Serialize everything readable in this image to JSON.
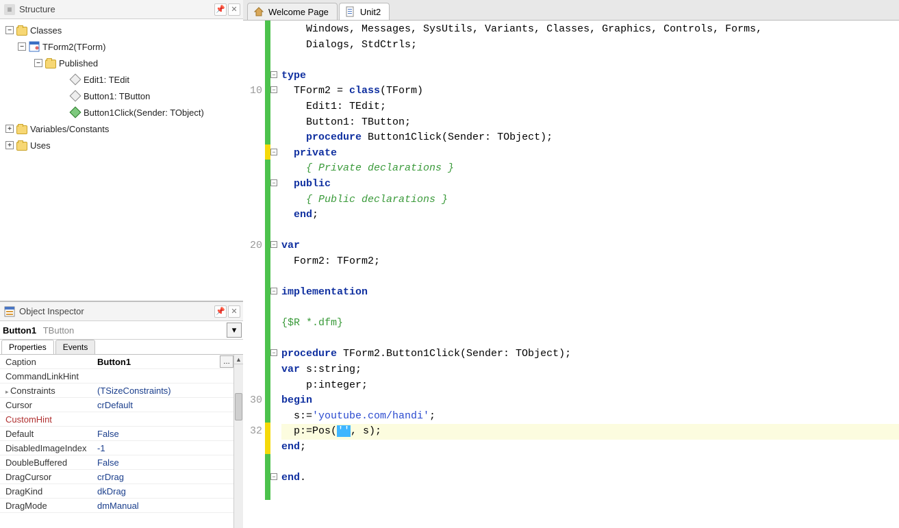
{
  "structure": {
    "title": "Structure",
    "nodes": {
      "classes": "Classes",
      "tform2": "TForm2(TForm)",
      "published": "Published",
      "edit1": "Edit1: TEdit",
      "button1": "Button1: TButton",
      "button1click": "Button1Click(Sender: TObject)",
      "varsconsts": "Variables/Constants",
      "uses": "Uses"
    }
  },
  "inspector": {
    "title": "Object Inspector",
    "selector_name": "Button1",
    "selector_class": "TButton",
    "tab_props": "Properties",
    "tab_events": "Events",
    "rows": [
      {
        "name": "Caption",
        "value": "Button1",
        "sel": true,
        "btn": true
      },
      {
        "name": "CommandLinkHint",
        "value": ""
      },
      {
        "name": "Constraints",
        "value": "(TSizeConstraints)",
        "expandable": true
      },
      {
        "name": "Cursor",
        "value": "crDefault"
      },
      {
        "name": "CustomHint",
        "value": "",
        "red": true
      },
      {
        "name": "Default",
        "value": "False"
      },
      {
        "name": "DisabledImageIndex",
        "value": "-1"
      },
      {
        "name": "DoubleBuffered",
        "value": "False"
      },
      {
        "name": "DragCursor",
        "value": "crDrag"
      },
      {
        "name": "DragKind",
        "value": "dkDrag"
      },
      {
        "name": "DragMode",
        "value": "dmManual"
      }
    ]
  },
  "tabs": {
    "welcome": "Welcome Page",
    "unit2": "Unit2"
  },
  "code": {
    "line_numbers": {
      "l10": "10",
      "l20": "20",
      "l30": "30",
      "l32": "32"
    },
    "l1": "    Windows, Messages, SysUtils, Variants, Classes, Graphics, Controls, Forms,",
    "l2": "    Dialogs, StdCtrls;",
    "type": "type",
    "l5a": "  TForm2 = ",
    "l5b": "class",
    "l5c": "(TForm)",
    "l6": "    Edit1: TEdit;",
    "l7": "    Button1: TButton;",
    "l8a": "    ",
    "l8b": "procedure",
    "l8c": " Button1Click(Sender: TObject);",
    "private": "  private",
    "privdecl": "    { Private declarations }",
    "public": "  public",
    "pubdecl": "    { Public declarations }",
    "end1": "  end;",
    "var": "var",
    "form2": "  Form2: TForm2;",
    "impl": "implementation",
    "rdfm": "{$R *.dfm}",
    "proc_a": "procedure",
    "proc_b": " TForm2.Button1Click(Sender: TObject);",
    "vars_a": "var",
    "vars_b": " s:string;",
    "vars_c": "    p:integer;",
    "begin": "begin",
    "assign_a": "  s:=",
    "assign_str": "'youtube.com/handi'",
    "assign_b": ";",
    "pos_a": "  p:=Pos(",
    "pos_sel": "''",
    "pos_b": ", s);",
    "end2": "end;",
    "endfinal": "end."
  }
}
